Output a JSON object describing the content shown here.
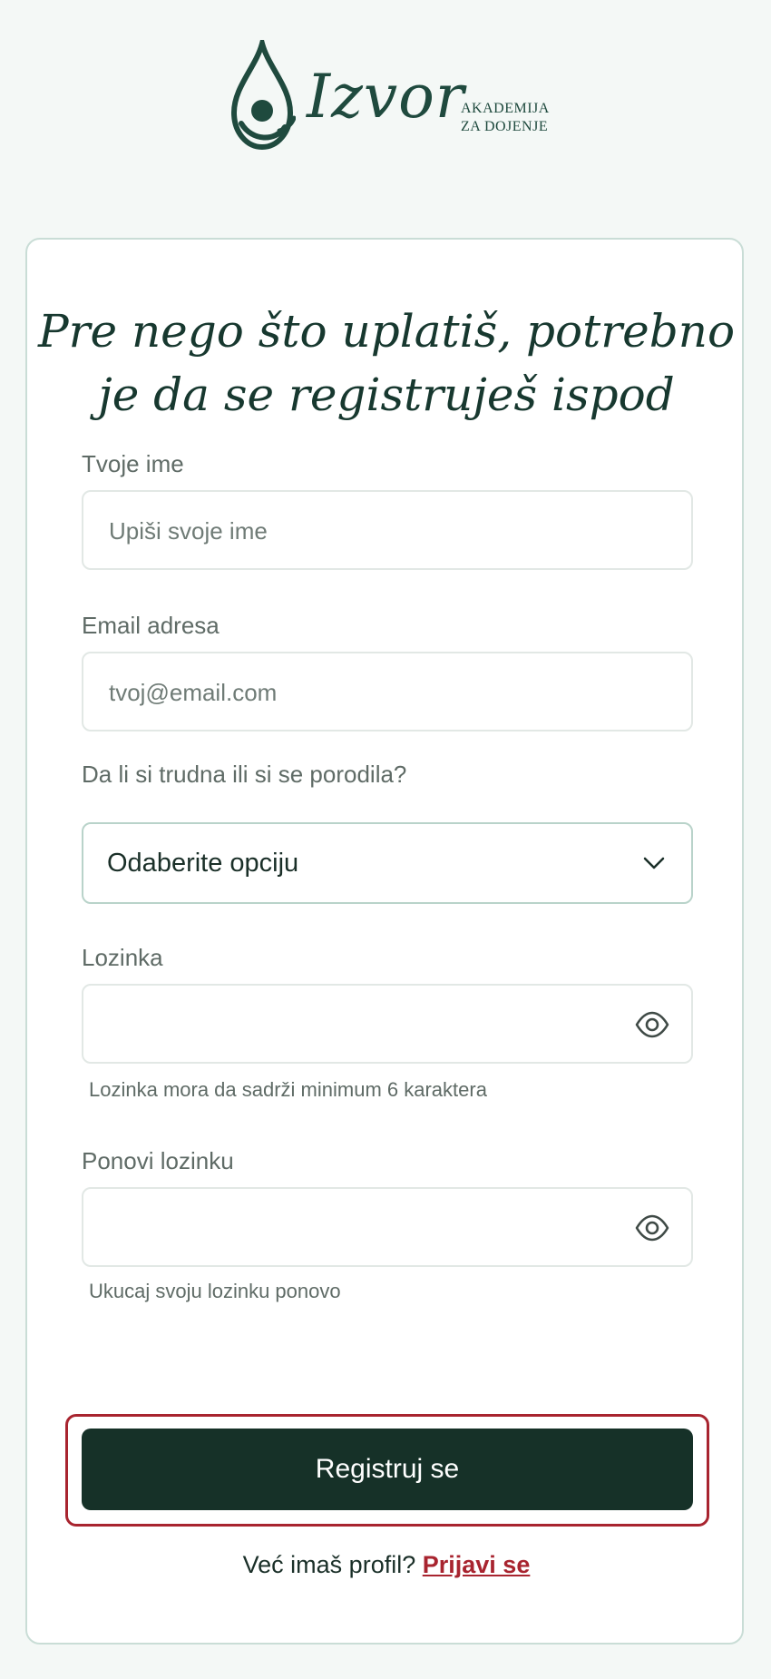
{
  "logo": {
    "wordmark": "Izvor",
    "subtitle_line1": "AKADEMIJA",
    "subtitle_line2": "ZA DOJENJE"
  },
  "form": {
    "headline": "Pre nego što uplatiš, potrebno je da se registruješ ispod",
    "name_label": "Tvoje ime",
    "name_placeholder": "Upiši svoje ime",
    "email_label": "Email adresa",
    "email_placeholder": "tvoj@email.com",
    "status_label": "Da li si trudna ili si se porodila?",
    "status_selected": "Odaberite opciju",
    "password_label": "Lozinka",
    "password_hint": "Lozinka mora da sadrži minimum 6 karaktera",
    "repeat_label": "Ponovi lozinku",
    "repeat_hint": "Ukucaj svoju lozinku ponovo",
    "submit_label": "Registruj se",
    "login_prompt": "Već imaš profil?",
    "login_link": "Prijavi se"
  },
  "icons": {
    "password_toggle": "eye-icon",
    "select_arrow": "chevron-down-icon",
    "logo_mark": "water-drop-icon"
  },
  "colors": {
    "brand_green": "#163128",
    "accent_red": "#a8242f",
    "logo_green": "#1f4a3e"
  }
}
